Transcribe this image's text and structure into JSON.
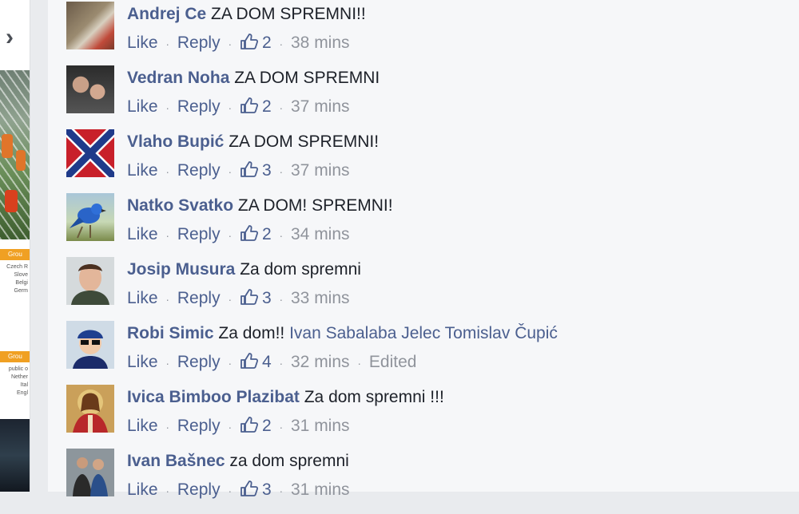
{
  "labels": {
    "like": "Like",
    "reply": "Reply",
    "separator": "·"
  },
  "left_panel": {
    "group_a": {
      "header": "Grou",
      "items": [
        "Czech R",
        "Slove",
        "Belgi",
        "Germ"
      ]
    },
    "group_b": {
      "header": "Grou",
      "items": [
        "public o",
        "Nether",
        "Ital",
        "Engl"
      ]
    }
  },
  "comments": [
    {
      "author": "Andrej Ce",
      "text": "ZA DOM SPREMNI!!",
      "likes": "2",
      "time": "38 mins",
      "avatar_icon": "profile-photo"
    },
    {
      "author": "Vedran Noha",
      "text": "ZA DOM SPREMNI",
      "likes": "2",
      "time": "37 mins",
      "avatar_icon": "profile-photo"
    },
    {
      "author": "Vlaho Bupić",
      "text": "ZA DOM SPREMNI!",
      "likes": "3",
      "time": "37 mins",
      "avatar_icon": "confederate-flag-photo"
    },
    {
      "author": "Natko Svatko",
      "text": "ZA DOM! SPREMNI!",
      "likes": "2",
      "time": "34 mins",
      "avatar_icon": "bird-photo"
    },
    {
      "author": "Josip Musura",
      "text": "Za dom spremni",
      "likes": "3",
      "time": "33 mins",
      "avatar_icon": "profile-photo"
    },
    {
      "author": "Robi Simic",
      "text": "Za dom!!",
      "tagged": "Ivan Sabalaba Jelec Tomislav Čupić",
      "likes": "4",
      "time": "32 mins",
      "edited": "Edited",
      "avatar_icon": "cartoon-photo"
    },
    {
      "author": "Ivica Bimboo Plazibat",
      "text": "Za dom spremni !!!",
      "likes": "2",
      "time": "31 mins",
      "avatar_icon": "religious-art-photo"
    },
    {
      "author": "Ivan Bašnec",
      "text": "za dom spremni",
      "likes": "3",
      "time": "31 mins",
      "avatar_icon": "profile-photo"
    }
  ],
  "colors": {
    "name_link": "#4b5f8f",
    "meta_gray": "#90949c",
    "text": "#1d2129",
    "background": "#f6f7f9"
  }
}
